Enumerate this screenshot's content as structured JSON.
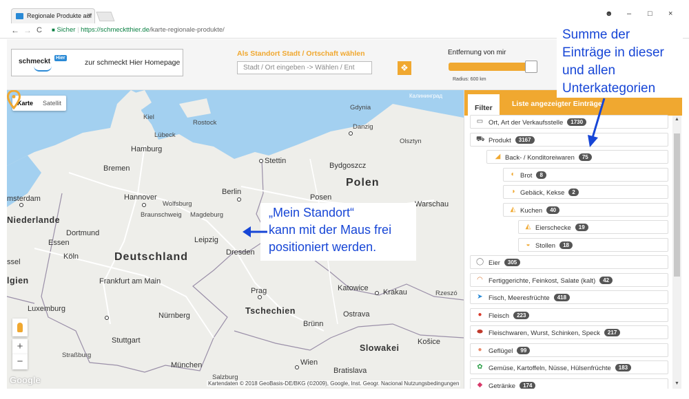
{
  "browser": {
    "tab_title": "Regionale Produkte auf",
    "close_glyph": "×",
    "secure_label": "Sicher",
    "url_host": "https://schmecktthier.de",
    "url_path": "/karte-regionale-produkte/",
    "back_glyph": "←",
    "forward_glyph": "→",
    "reload_glyph": "C",
    "lock_glyph": "🔒",
    "account_glyph": "☻",
    "min_glyph": "–",
    "max_glyph": "□",
    "winclose_glyph": "×"
  },
  "header": {
    "logo_text": "schmeckt",
    "logo_badge": "Hier",
    "home_link": "zur schmeckt Hier Homepage",
    "location_label": "Als Standort Stadt / Ortschaft wählen",
    "location_placeholder": "Stadt / Ort eingeben -> Wählen / Ent",
    "distance_label": "Entfernung von mir",
    "radius_text": "Radius: 600 km",
    "distance_slider_fraction": 0.95
  },
  "map": {
    "mode_map": "Karte",
    "mode_satellite": "Satellit",
    "zoom_in": "+",
    "zoom_out": "−",
    "google_logo": "Google",
    "attribution": "Kartendaten © 2018 GeoBasis-DE/BKG (©2009), Google, Inst. Geogr. Nacional    Nutzungsbedingungen",
    "cities": {
      "gdynia": "Gdynia",
      "gdynia_ru": "Калининград",
      "gdansk": "Danzig",
      "kalin_ru": "Калининград",
      "olsztyn": "Olsztyn",
      "kiel": "Kiel",
      "lubeck": "Lübeck",
      "rostock": "Rostock",
      "hamburg": "Hamburg",
      "stettin": "Stettin",
      "bremen": "Bremen",
      "bydgoszcz": "Bydgoszcz",
      "polen": "Polen",
      "amsterdam": "msterdam",
      "hannover": "Hannover",
      "wolfsburg": "Wolfsburg",
      "berlin": "Berlin",
      "posen": "Posen",
      "warschau": "Warschau",
      "niederlande": "Niederlande",
      "braunschweig": "Braunschweig",
      "magdeburg": "Magdeburg",
      "dortmund": "Dortmund",
      "essen": "Essen",
      "leipzig": "Leipzig",
      "deutschland": "Deutschland",
      "dresden": "Dresden",
      "koln": "Köln",
      "ssel": "ssel",
      "belgien": "lgien",
      "frankfurt": "Frankfurt am Main",
      "prag": "Prag",
      "katowice": "Katowice",
      "krakau": "Krakau",
      "rzeszow": "Rzeszó",
      "luxemburg": "Luxemburg",
      "nurnberg": "Nürnberg",
      "tschechien": "Tschechien",
      "brunn": "Brünn",
      "ostrava": "Ostrava",
      "stuttgart": "Stuttgart",
      "strasbourg": "Straßburg",
      "slowakei": "Slowakei",
      "kosice": "Košice",
      "munchen": "München",
      "wien": "Wien",
      "bratislava": "Bratislava",
      "salzburg": "Salzburg"
    },
    "annotation_lines": [
      "„Mein Standort“",
      "kann mit der Maus frei",
      "positioniert werden."
    ]
  },
  "annotation_top": {
    "lines": [
      "Summe der",
      "Einträge in dieser",
      "und allen",
      "Unterkategorien"
    ]
  },
  "sidebar": {
    "tab_filter": "Filter",
    "tab_list": "Liste angezeigter Einträge",
    "items": [
      {
        "label": "Ort, Art der Verkaufsstelle",
        "count": "1730",
        "icon": "speech-bubble-icon",
        "glyph": "▭"
      },
      {
        "label": "Produkt",
        "count": "3167",
        "icon": "cart-icon",
        "glyph": "⛟"
      },
      {
        "label": "Back- / Konditoreiwaren",
        "count": "75",
        "icon": "pastry-icon",
        "glyph": "◢"
      },
      {
        "label": "Brot",
        "count": "8",
        "icon": "bread-icon",
        "glyph": "◐"
      },
      {
        "label": "Gebäck, Kekse",
        "count": "2",
        "icon": "cookie-icon",
        "glyph": "◑"
      },
      {
        "label": "Kuchen",
        "count": "40",
        "icon": "cake-icon",
        "glyph": "◭"
      },
      {
        "label": "Eierschecke",
        "count": "19",
        "icon": "cake-slice-icon",
        "glyph": "◭"
      },
      {
        "label": "Stollen",
        "count": "18",
        "icon": "stollen-icon",
        "glyph": "◒"
      },
      {
        "label": "Eier",
        "count": "305",
        "icon": "egg-icon",
        "glyph": "◯"
      },
      {
        "label": "Fertiggerichte, Feinkost, Salate (kalt)",
        "count": "42",
        "icon": "dish-icon",
        "glyph": "◠"
      },
      {
        "label": "Fisch, Meeresfrüchte",
        "count": "418",
        "icon": "fish-icon",
        "glyph": "➤"
      },
      {
        "label": "Fleisch",
        "count": "223",
        "icon": "meat-icon",
        "glyph": "●"
      },
      {
        "label": "Fleischwaren, Wurst, Schinken, Speck",
        "count": "217",
        "icon": "sausage-icon",
        "glyph": "⬬"
      },
      {
        "label": "Geflügel",
        "count": "99",
        "icon": "poultry-icon",
        "glyph": "●"
      },
      {
        "label": "Gemüse, Kartoffeln, Nüsse, Hülsenfrüchte",
        "count": "183",
        "icon": "vegetable-icon",
        "glyph": "✿"
      },
      {
        "label": "Getränke",
        "count": "174",
        "icon": "drink-icon",
        "glyph": "◆"
      }
    ],
    "colors": {
      "accent": "#f0a830",
      "badge": "#555555"
    }
  }
}
